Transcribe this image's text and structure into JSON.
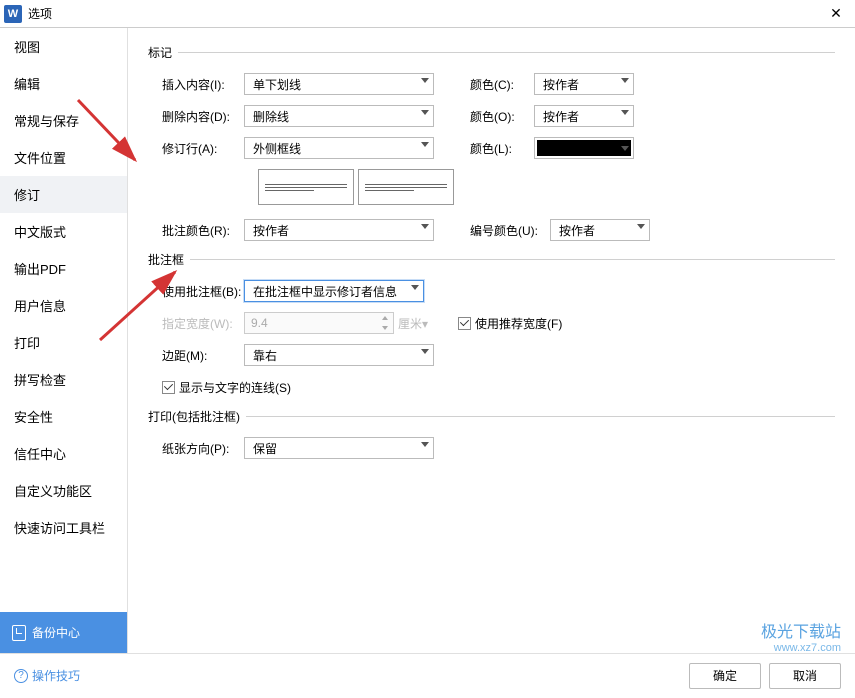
{
  "titlebar": {
    "title": "选项"
  },
  "sidebar": {
    "items": [
      {
        "label": "视图"
      },
      {
        "label": "编辑"
      },
      {
        "label": "常规与保存"
      },
      {
        "label": "文件位置"
      },
      {
        "label": "修订",
        "selected": true
      },
      {
        "label": "中文版式"
      },
      {
        "label": "输出PDF"
      },
      {
        "label": "用户信息"
      },
      {
        "label": "打印"
      },
      {
        "label": "拼写检查"
      },
      {
        "label": "安全性"
      },
      {
        "label": "信任中心"
      },
      {
        "label": "自定义功能区"
      },
      {
        "label": "快速访问工具栏"
      }
    ],
    "backup": "备份中心"
  },
  "marks": {
    "group": "标记",
    "insert_label": "插入内容(I):",
    "insert_value": "单下划线",
    "delete_label": "删除内容(D):",
    "delete_value": "删除线",
    "line_label": "修订行(A):",
    "line_value": "外侧框线",
    "colorC_label": "颜色(C):",
    "colorC_value": "按作者",
    "colorO_label": "颜色(O):",
    "colorO_value": "按作者",
    "colorL_label": "颜色(L):",
    "comment_color_label": "批注颜色(R):",
    "comment_color_value": "按作者",
    "number_color_label": "编号颜色(U):",
    "number_color_value": "按作者"
  },
  "balloon": {
    "group": "批注框",
    "use_label": "使用批注框(B):",
    "use_value": "在批注框中显示修订者信息",
    "width_label": "指定宽度(W):",
    "width_value": "9.4",
    "width_unit": "厘米▾",
    "rec_width": "使用推荐宽度(F)",
    "margin_label": "边距(M):",
    "margin_value": "靠右",
    "show_line": "显示与文字的连线(S)"
  },
  "print": {
    "group": "打印(包括批注框)",
    "orient_label": "纸张方向(P):",
    "orient_value": "保留"
  },
  "footer": {
    "tips": "操作技巧",
    "ok": "确定",
    "cancel": "取消"
  },
  "watermark": {
    "l1": "极光下载站",
    "l2": "www.xz7.com"
  }
}
